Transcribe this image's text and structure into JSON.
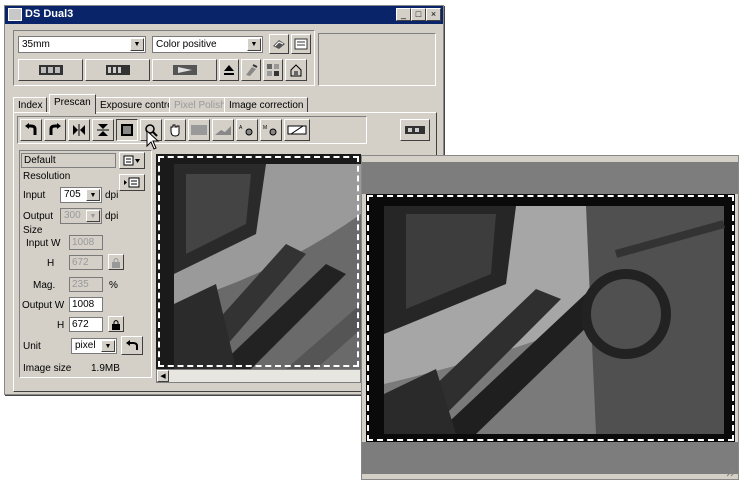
{
  "window": {
    "title": "DS Dual3",
    "min": "_",
    "max": "□",
    "close": "×"
  },
  "film_type": "35mm",
  "color_mode": "Color positive",
  "tabs": [
    {
      "label": "Index"
    },
    {
      "label": "Prescan"
    },
    {
      "label": "Exposure control"
    },
    {
      "label": "Pixel Polish"
    },
    {
      "label": "Image correction"
    }
  ],
  "settings": {
    "preset": "Default",
    "resolution_label": "Resolution",
    "input_label": "Input",
    "input_value": "705",
    "dpi": "dpi",
    "output_label": "Output",
    "output_value": "300",
    "size_label": "Size",
    "input_w_label": "Input W",
    "input_w_value": "1008",
    "h_label": "H",
    "input_h_value": "672",
    "mag_label": "Mag.",
    "mag_value": "235",
    "percent": "%",
    "output_w_label": "Output W",
    "output_w_value": "1008",
    "output_h_value": "672",
    "unit_label": "Unit",
    "unit_value": "pixel",
    "image_size_label": "Image size",
    "image_size_value": "1.9MB"
  },
  "colors": {
    "titlebar": "#0a246a",
    "chrome": "#d4d0c8",
    "preview_bar": "#7d7d7d"
  }
}
